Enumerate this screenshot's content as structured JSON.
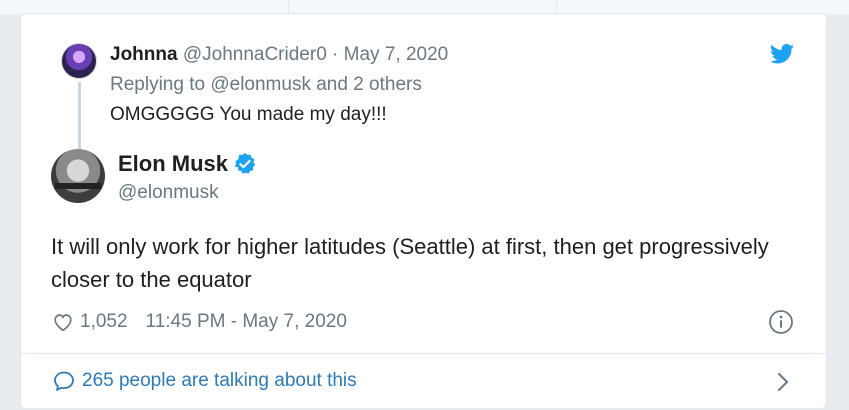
{
  "parent_tweet": {
    "display_name": "Johnna",
    "handle": "@JohnnaCrider0",
    "separator": "·",
    "date": "May 7, 2020",
    "replying_to": "Replying to @elonmusk and 2 others",
    "text": "OMGGGGG You made my day!!!"
  },
  "tweet": {
    "display_name": "Elon Musk",
    "handle": "@elonmusk",
    "text": "It will only work for higher latitudes (Seattle) at first, then get progressively closer to the equator",
    "like_count": "1,052",
    "timestamp": "11:45 PM - May 7, 2020"
  },
  "footer": {
    "talking_text": "265 people are talking about this"
  },
  "icons": {
    "brand": "twitter-bird-icon",
    "verified": "verified-badge-icon",
    "like": "heart-icon",
    "info": "info-icon",
    "conversation": "speech-bubble-icon",
    "open": "chevron-right-icon"
  },
  "colors": {
    "accent": "#1da1f2",
    "link": "#2b7bb9",
    "muted": "#697882"
  }
}
